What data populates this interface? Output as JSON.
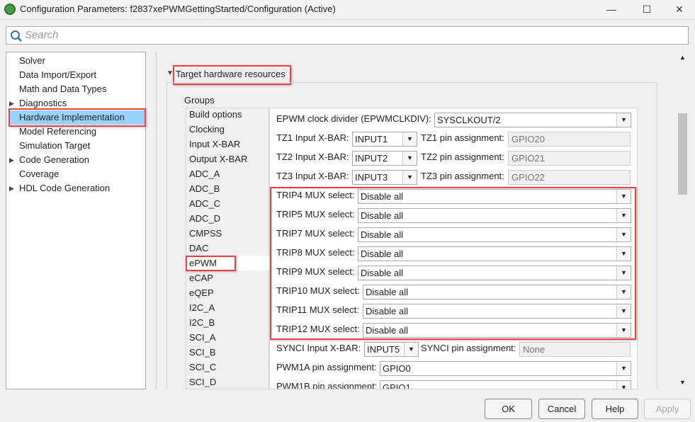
{
  "window": {
    "title": "Configuration Parameters: f2837xePWMGettingStarted/Configuration (Active)",
    "minimize": "—",
    "maximize": "☐",
    "close": "✕"
  },
  "search": {
    "placeholder": "Search"
  },
  "tree": [
    {
      "label": "Solver",
      "expandable": false
    },
    {
      "label": "Data Import/Export",
      "expandable": false
    },
    {
      "label": "Math and Data Types",
      "expandable": false
    },
    {
      "label": "Diagnostics",
      "expandable": true
    },
    {
      "label": "Hardware Implementation",
      "expandable": false,
      "selected": true
    },
    {
      "label": "Model Referencing",
      "expandable": false
    },
    {
      "label": "Simulation Target",
      "expandable": false
    },
    {
      "label": "Code Generation",
      "expandable": true
    },
    {
      "label": "Coverage",
      "expandable": false
    },
    {
      "label": "HDL Code Generation",
      "expandable": true
    }
  ],
  "section": {
    "title": "Target hardware resources",
    "groups_label": "Groups"
  },
  "groups": [
    "Build options",
    "Clocking",
    "Input X-BAR",
    "Output X-BAR",
    "ADC_A",
    "ADC_B",
    "ADC_C",
    "ADC_D",
    "CMPSS",
    "DAC",
    "ePWM",
    "eCAP",
    "eQEP",
    "I2C_A",
    "I2C_B",
    "SCI_A",
    "SCI_B",
    "SCI_C",
    "SCI_D"
  ],
  "selected_group": "ePWM",
  "form": {
    "clkdiv": {
      "label": "EPWM clock divider (EPWMCLKDIV):",
      "value": "SYSCLKOUT/2"
    },
    "tz": [
      {
        "label": "TZ1 Input X-BAR:",
        "value": "INPUT1",
        "pin_label": "TZ1 pin assignment:",
        "pin": "GPIO20"
      },
      {
        "label": "TZ2 Input X-BAR:",
        "value": "INPUT2",
        "pin_label": "TZ2 pin assignment:",
        "pin": "GPIO21"
      },
      {
        "label": "TZ3 Input X-BAR:",
        "value": "INPUT3",
        "pin_label": "TZ3 pin assignment:",
        "pin": "GPIO22"
      }
    ],
    "trip": [
      {
        "label": "TRIP4 MUX select:",
        "value": "Disable all"
      },
      {
        "label": "TRIP5 MUX select:",
        "value": "Disable all"
      },
      {
        "label": "TRIP7 MUX select:",
        "value": "Disable all"
      },
      {
        "label": "TRIP8 MUX select:",
        "value": "Disable all"
      },
      {
        "label": "TRIP9 MUX select:",
        "value": "Disable all"
      },
      {
        "label": "TRIP10 MUX select:",
        "value": "Disable all"
      },
      {
        "label": "TRIP11 MUX select:",
        "value": "Disable all"
      },
      {
        "label": "TRIP12 MUX select:",
        "value": "Disable all"
      }
    ],
    "synci": {
      "label": "SYNCI Input X-BAR:",
      "value": "INPUT5",
      "pin_label": "SYNCI pin assignment:",
      "pin": "None"
    },
    "pwm1a": {
      "label": "PWM1A pin assignment:",
      "value": "GPIO0"
    },
    "pwm1b": {
      "label": "PWM1B pin assignment:",
      "value": "GPIO1"
    }
  },
  "buttons": {
    "ok": "OK",
    "cancel": "Cancel",
    "help": "Help",
    "apply": "Apply"
  }
}
